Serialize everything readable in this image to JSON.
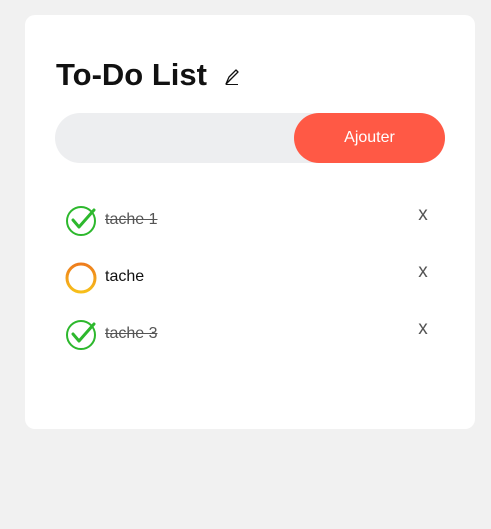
{
  "header": {
    "title": "To-Do List",
    "title_icon": "pen-nib-icon"
  },
  "input": {
    "value": "",
    "placeholder": "",
    "add_button_label": "Ajouter"
  },
  "tasks": [
    {
      "text": "tache 1",
      "done": true,
      "delete_label": "x"
    },
    {
      "text": "tache",
      "done": false,
      "delete_label": "x"
    },
    {
      "text": "tache 3",
      "done": true,
      "delete_label": "x"
    }
  ],
  "colors": {
    "accent": "#ff5945",
    "page_background": "#f1f1f1",
    "card_background": "#ffffff",
    "input_background": "#edeef0",
    "done_check": "#2db82d",
    "pending_circle": "#f2a20c"
  }
}
